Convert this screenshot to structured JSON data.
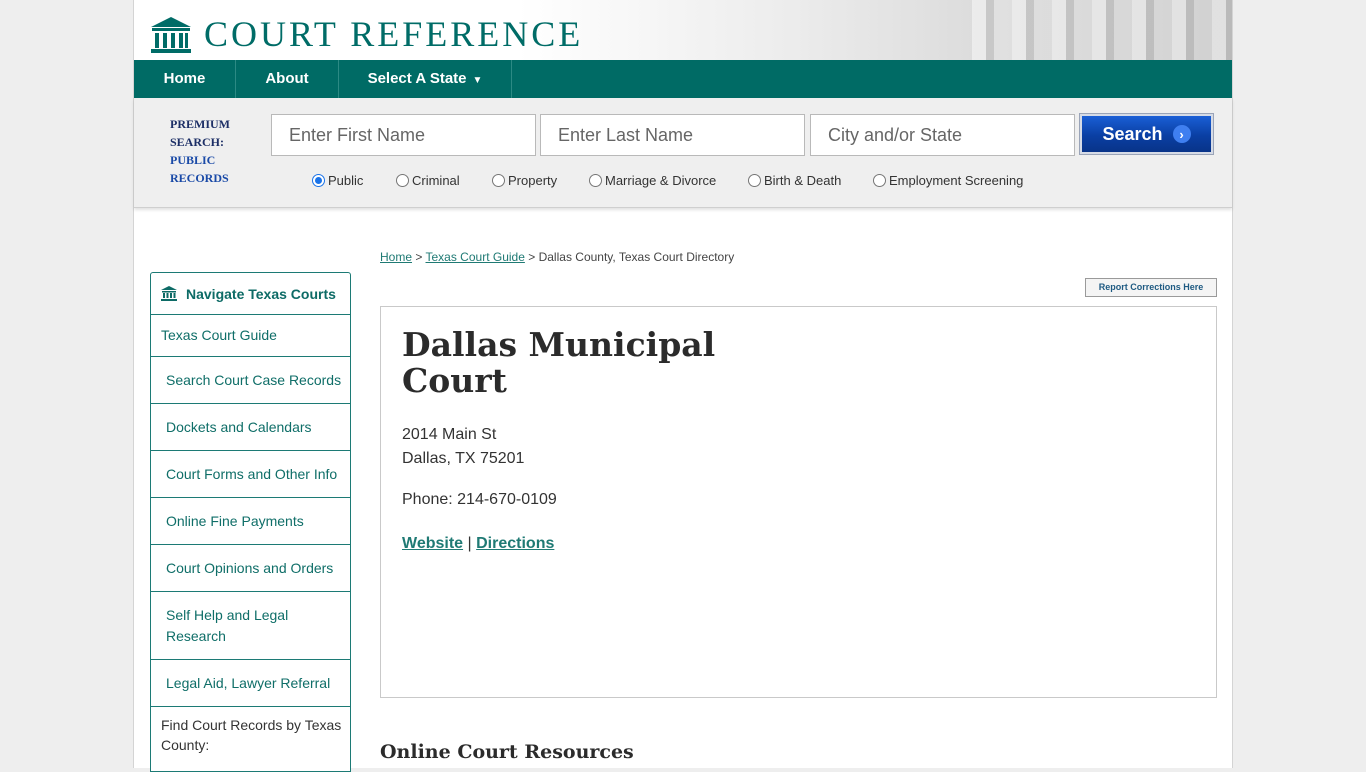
{
  "brand": {
    "name": "COURT REFERENCE"
  },
  "nav": {
    "items": [
      {
        "label": "Home"
      },
      {
        "label": "About"
      },
      {
        "label": "Select A State",
        "arrow": "▼"
      }
    ]
  },
  "search": {
    "premium_line1": "PREMIUM",
    "premium_line2": "SEARCH:",
    "premium_line3": "PUBLIC",
    "premium_line4": "RECORDS",
    "first_name_placeholder": "Enter First Name",
    "last_name_placeholder": "Enter Last Name",
    "city_placeholder": "City and/or State",
    "button_label": "Search",
    "button_icon": "chevron-right-icon",
    "selected_type": "Public",
    "types": [
      "Public",
      "Criminal",
      "Property",
      "Marriage & Divorce",
      "Birth & Death",
      "Employment Screening"
    ]
  },
  "breadcrumb": {
    "home": "Home",
    "sep": ">",
    "guide": "Texas Court Guide",
    "current": "Dallas County, Texas Court Directory"
  },
  "report": {
    "label": "Report Corrections Here"
  },
  "sidebar": {
    "title": "Navigate Texas Courts",
    "title_icon": "courthouse-icon",
    "items": [
      "Texas Court Guide",
      "Search Court Case Records",
      "Dockets and Calendars",
      "Court Forms and Other Info",
      "Online Fine Payments",
      "Court Opinions and Orders",
      "Self Help and Legal Research",
      "Legal Aid, Lawyer Referral"
    ],
    "county_label": "Find Court Records by Texas County:"
  },
  "court": {
    "name": "Dallas Municipal Court",
    "street": "2014 Main St",
    "city_line": "Dallas, TX 75201",
    "phone": "Phone: 214-670-0109",
    "website_label": "Website",
    "link_sep": "|",
    "directions_label": "Directions"
  },
  "resources": {
    "title": "Online Court Resources"
  },
  "colors": {
    "brand_teal": "#006b65",
    "link_teal": "#1f7a74",
    "search_blue": "#0a3fa3",
    "page_bg": "#eeeeee"
  }
}
